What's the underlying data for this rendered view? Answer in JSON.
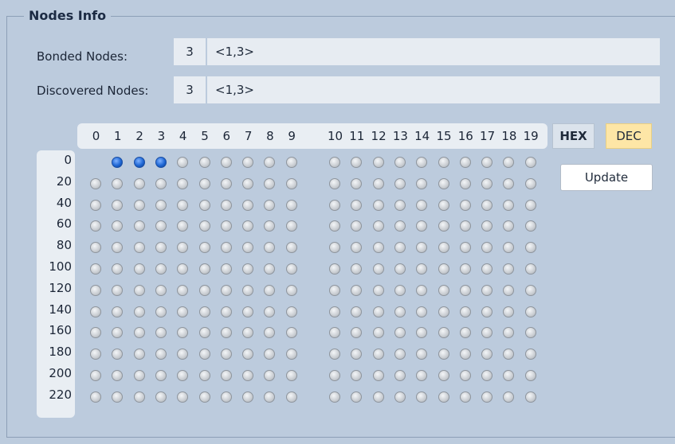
{
  "group": {
    "title": "Nodes Info"
  },
  "bonded": {
    "label": "Bonded Nodes:",
    "count": "3",
    "list": "<1,3>"
  },
  "discovered": {
    "label": "Discovered Nodes:",
    "count": "3",
    "list": "<1,3>"
  },
  "grid": {
    "columns": [
      "0",
      "1",
      "2",
      "3",
      "4",
      "5",
      "6",
      "7",
      "8",
      "9",
      "10",
      "11",
      "12",
      "13",
      "14",
      "15",
      "16",
      "17",
      "18",
      "19"
    ],
    "rows": [
      "0",
      "20",
      "40",
      "60",
      "80",
      "100",
      "120",
      "140",
      "160",
      "180",
      "200",
      "220"
    ],
    "active_nodes": [
      1,
      2,
      3
    ]
  },
  "buttons": {
    "hex": "HEX",
    "dec": "DEC",
    "update": "Update"
  },
  "colors": {
    "active_led": "#1f67d4",
    "inactive_led": "#c9cdd2",
    "dec_selected": "#fde6a6",
    "background": "#bccbdd"
  }
}
